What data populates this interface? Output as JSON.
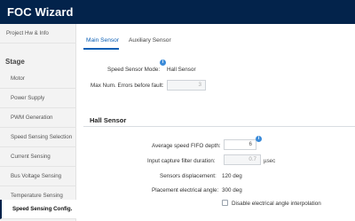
{
  "app": {
    "title": "FOC Wizard"
  },
  "sidebar": {
    "top_item": "Project Hw & Info",
    "section_label": "Stage",
    "items": [
      "Motor",
      "Power Supply",
      "PWM Generation",
      "Speed Sensing Selection",
      "Current Sensing",
      "Bus Voltage Sensing",
      "Temperature Sensing",
      "Speed Sensing Config."
    ],
    "active_item": "Speed Sensing Config."
  },
  "tabs": {
    "items": [
      "Main Sensor",
      "Auxiliary Sensor"
    ],
    "active": "Main Sensor"
  },
  "main_sensor": {
    "mode_label": "Speed Sensor Mode:",
    "mode_value": "Hall Sensor",
    "max_errors_label": "Max Num. Errors before fault:",
    "max_errors_value": "3"
  },
  "hall_sensor": {
    "title": "Hall Sensor",
    "fifo_label": "Average speed FIFO depth:",
    "fifo_value": "6",
    "filter_label": "Input capture filter duration:",
    "filter_value": "0.7",
    "filter_unit": "µsec",
    "displacement_label": "Sensors displacement:",
    "displacement_value": "120 deg",
    "placement_label": "Placement electrical angle:",
    "placement_value": "300 deg",
    "disable_interp_label": "Disable electrical angle interpolation",
    "disable_interp_checked": false
  },
  "colors": {
    "header": "#03234b",
    "accent": "#0b5fb5",
    "info": "#3b8bd9"
  }
}
